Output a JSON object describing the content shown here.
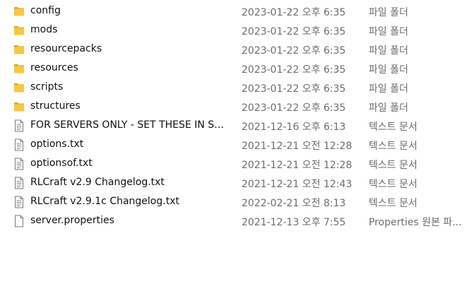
{
  "colors": {
    "folder": "#F8C743",
    "folder_dark": "#E0A823",
    "text": "#111111",
    "muted_text": "#6d6d6d"
  },
  "files": [
    {
      "icon": "folder-icon",
      "name": "config",
      "modified": "2023-01-22 오후 6:35",
      "type": "파일 폴더"
    },
    {
      "icon": "folder-icon",
      "name": "mods",
      "modified": "2023-01-22 오후 6:35",
      "type": "파일 폴더"
    },
    {
      "icon": "folder-icon",
      "name": "resourcepacks",
      "modified": "2023-01-22 오후 6:35",
      "type": "파일 폴더"
    },
    {
      "icon": "folder-icon",
      "name": "resources",
      "modified": "2023-01-22 오후 6:35",
      "type": "파일 폴더"
    },
    {
      "icon": "folder-icon",
      "name": "scripts",
      "modified": "2023-01-22 오후 6:35",
      "type": "파일 폴더"
    },
    {
      "icon": "folder-icon",
      "name": "structures",
      "modified": "2023-01-22 오후 6:35",
      "type": "파일 폴더"
    },
    {
      "icon": "text-file-icon",
      "name": "FOR SERVERS ONLY - SET THESE IN SE...",
      "modified": "2021-12-16 오후 6:13",
      "type": "텍스트 문서"
    },
    {
      "icon": "text-file-icon",
      "name": "options.txt",
      "modified": "2021-12-21 오전 12:28",
      "type": "텍스트 문서"
    },
    {
      "icon": "text-file-icon",
      "name": "optionsof.txt",
      "modified": "2021-12-21 오전 12:28",
      "type": "텍스트 문서"
    },
    {
      "icon": "text-file-icon",
      "name": "RLCraft v2.9 Changelog.txt",
      "modified": "2021-12-21 오전 12:43",
      "type": "텍스트 문서"
    },
    {
      "icon": "text-file-icon",
      "name": "RLCraft v2.9.1c Changelog.txt",
      "modified": "2022-02-21 오전 8:13",
      "type": "텍스트 문서"
    },
    {
      "icon": "file-icon",
      "name": "server.properties",
      "modified": "2021-12-13 오후 7:55",
      "type": "Properties 원본 파..."
    }
  ]
}
